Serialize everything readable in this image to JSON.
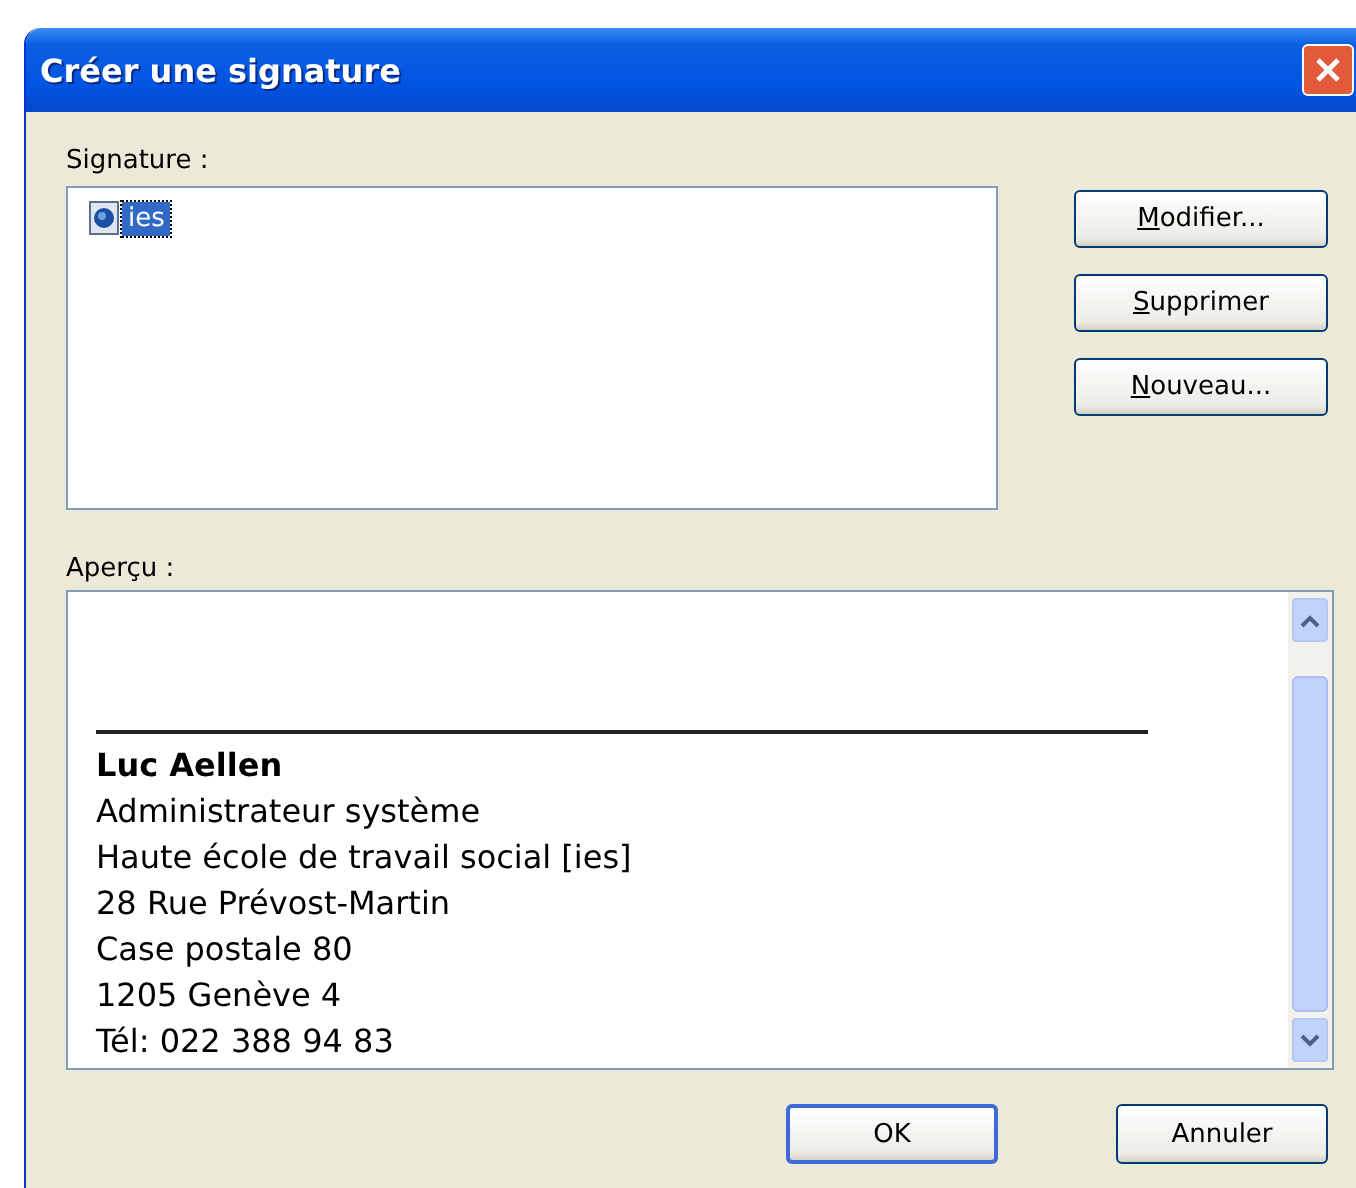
{
  "window": {
    "title": "Créer une signature"
  },
  "signature_list": {
    "label": "Signature :",
    "items": [
      {
        "name": "ies",
        "selected": true
      }
    ]
  },
  "side_buttons": [
    {
      "label": "Modifier...",
      "underline_first": true
    },
    {
      "label": "Supprimer",
      "underline_first": true
    },
    {
      "label": "Nouveau...",
      "underline_first": true
    }
  ],
  "preview": {
    "label": "Aperçu :",
    "rule": true,
    "name": "Luc Aellen",
    "lines": [
      "Administrateur système",
      "Haute école de travail social [ies]",
      "28 Rue Prévost-Martin",
      "Case postale 80",
      "1205 Genève 4",
      "Tél: 022 388 94 83"
    ]
  },
  "buttons": [
    {
      "label": "OK",
      "default": true
    },
    {
      "label": "Annuler",
      "default": false
    }
  ]
}
